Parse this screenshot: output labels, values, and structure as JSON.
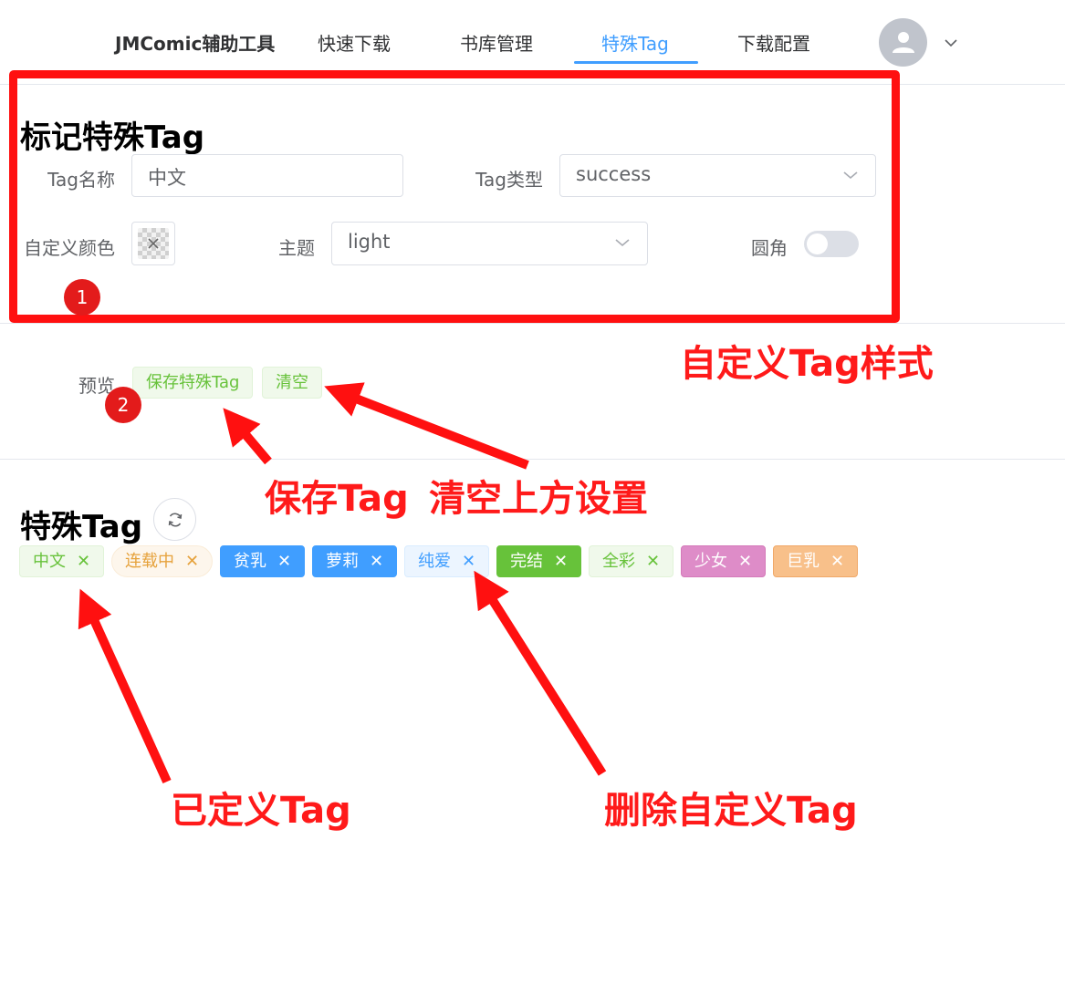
{
  "header": {
    "brand": "JMComic辅助工具",
    "nav": [
      {
        "label": "快速下载",
        "active": false
      },
      {
        "label": "书库管理",
        "active": false
      },
      {
        "label": "特殊Tag",
        "active": true
      },
      {
        "label": "下载配置",
        "active": false
      }
    ],
    "avatar_icon": "user-icon",
    "menu_icon": "chevron-down-icon"
  },
  "form": {
    "title": "标记特殊Tag",
    "tag_name_label": "Tag名称",
    "tag_name_value": "中文",
    "tag_type_label": "Tag类型",
    "tag_type_value": "success",
    "custom_color_label": "自定义颜色",
    "theme_label": "主题",
    "theme_value": "light",
    "round_label": "圆角",
    "round_enabled": false
  },
  "preview": {
    "label": "预览",
    "save_button": "保存特殊Tag",
    "clear_button": "清空"
  },
  "special_tags": {
    "title": "特殊Tag",
    "refresh_icon": "refresh-icon",
    "tags": [
      {
        "label": "中文",
        "type": "success",
        "theme": "light"
      },
      {
        "label": "连载中",
        "type": "warning",
        "theme": "plain"
      },
      {
        "label": "贫乳",
        "type": "primary",
        "theme": "dark"
      },
      {
        "label": "萝莉",
        "type": "primary",
        "theme": "dark"
      },
      {
        "label": "纯爱",
        "type": "primary",
        "theme": "light"
      },
      {
        "label": "完结",
        "type": "success",
        "theme": "dark"
      },
      {
        "label": "全彩",
        "type": "success",
        "theme": "light"
      },
      {
        "label": "少女",
        "type": "custom",
        "theme": "dark",
        "color": "#de8cc8"
      },
      {
        "label": "巨乳",
        "type": "custom",
        "theme": "dark",
        "color": "#f8c08a"
      }
    ]
  },
  "annotations": {
    "badge1": "1",
    "badge2": "2",
    "custom_style": "自定义Tag样式",
    "save_tag": "保存Tag",
    "clear_settings": "清空上方设置",
    "defined_tag": "已定义Tag",
    "delete_tag": "删除自定义Tag"
  },
  "colors": {
    "accent": "#409eff",
    "success": "#67c23a",
    "annotation_red": "#ff1a1a"
  }
}
